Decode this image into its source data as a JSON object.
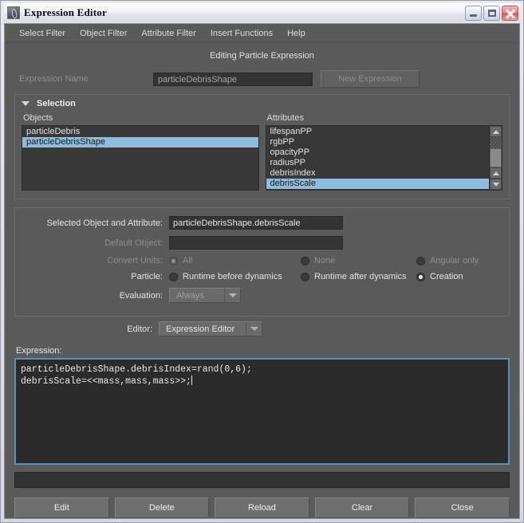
{
  "window": {
    "title": "Expression Editor",
    "icon": "maya-app-icon",
    "controls": {
      "minimize": "minimize",
      "maximize": "maximize",
      "close": "close"
    }
  },
  "menubar": {
    "items": [
      {
        "label": "Select Filter"
      },
      {
        "label": "Object Filter"
      },
      {
        "label": "Attribute Filter"
      },
      {
        "label": "Insert Functions"
      },
      {
        "label": "Help"
      }
    ]
  },
  "heading": "Editing Particle Expression",
  "expression_name": {
    "label": "Expression Name",
    "value": "particleDebrisShape",
    "new_button": "New Expression"
  },
  "selection": {
    "title": "Selection",
    "objects": {
      "header": "Objects",
      "items": [
        {
          "label": "particleDebris",
          "selected": false
        },
        {
          "label": "particleDebrisShape",
          "selected": true
        }
      ]
    },
    "attributes": {
      "header": "Attributes",
      "items": [
        {
          "label": "lifespanPP",
          "selected": false
        },
        {
          "label": "rgbPP",
          "selected": false
        },
        {
          "label": "opacityPP",
          "selected": false
        },
        {
          "label": "radiusPP",
          "selected": false
        },
        {
          "label": "debrisIndex",
          "selected": false
        },
        {
          "label": "debrisScale",
          "selected": true
        }
      ]
    }
  },
  "settings": {
    "selected_object_attribute": {
      "label": "Selected Object and Attribute:",
      "value": "particleDebrisShape.debrisScale"
    },
    "default_object": {
      "label": "Default Object:",
      "value": ""
    },
    "convert_units": {
      "label": "Convert Units:",
      "options": [
        {
          "label": "All",
          "selected": true
        },
        {
          "label": "None",
          "selected": false
        },
        {
          "label": "Angular only",
          "selected": false
        }
      ]
    },
    "particle": {
      "label": "Particle:",
      "options": [
        {
          "label": "Runtime before dynamics",
          "selected": false
        },
        {
          "label": "Runtime after dynamics",
          "selected": false
        },
        {
          "label": "Creation",
          "selected": true
        }
      ]
    },
    "evaluation": {
      "label": "Evaluation:",
      "value": "Always"
    }
  },
  "editor": {
    "label": "Editor:",
    "value": "Expression Editor"
  },
  "expression": {
    "label": "Expression:",
    "line1": "particleDebrisShape.debrisIndex=rand(0,6);",
    "line2": "debrisScale=<<mass,mass,mass>>;"
  },
  "status": {
    "text": ""
  },
  "buttons": [
    {
      "label": "Edit"
    },
    {
      "label": "Delete"
    },
    {
      "label": "Reload"
    },
    {
      "label": "Clear"
    },
    {
      "label": "Close"
    }
  ],
  "colors": {
    "window_chrome": "#e8e8ef",
    "app_background": "#5a5a5a",
    "field_background": "#343434",
    "selection_highlight": "#8fbcdb",
    "focus_border": "#5a90b8",
    "close_button": "#e05a5a"
  }
}
